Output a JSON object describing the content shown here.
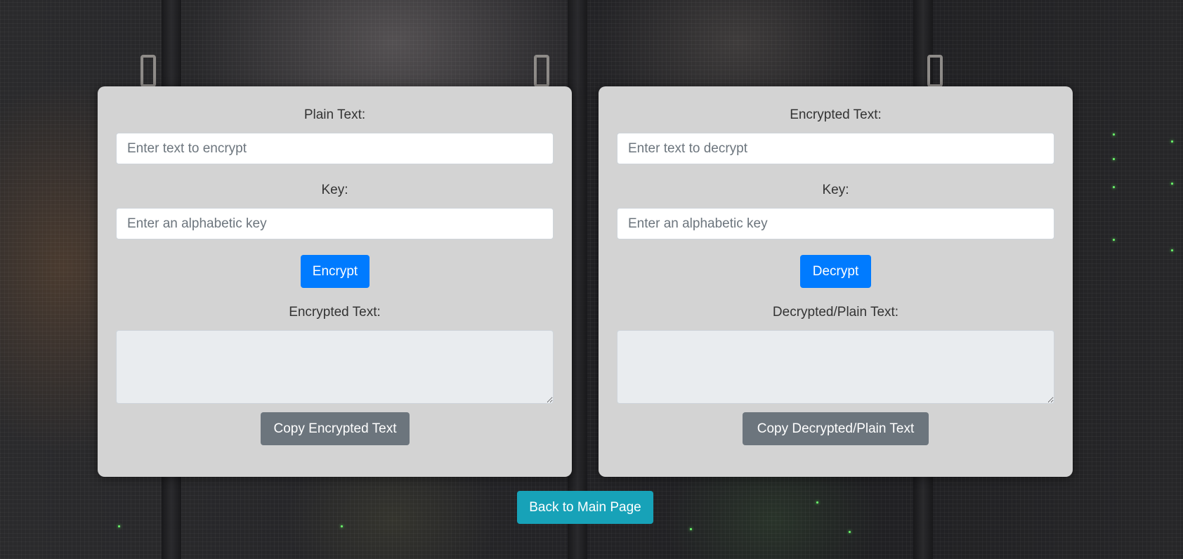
{
  "encrypt_panel": {
    "plain_label": "Plain Text:",
    "plain_placeholder": "Enter text to encrypt",
    "key_label": "Key:",
    "key_placeholder": "Enter an alphabetic key",
    "action_label": "Encrypt",
    "output_label": "Encrypted Text:",
    "output_value": "",
    "copy_label": "Copy Encrypted Text"
  },
  "decrypt_panel": {
    "cipher_label": "Encrypted Text:",
    "cipher_placeholder": "Enter text to decrypt",
    "key_label": "Key:",
    "key_placeholder": "Enter an alphabetic key",
    "action_label": "Decrypt",
    "output_label": "Decrypted/Plain Text:",
    "output_value": "",
    "copy_label": "Copy Decrypted/Plain Text"
  },
  "footer": {
    "back_label": "Back to Main Page"
  },
  "colors": {
    "primary": "#007bff",
    "secondary": "#6c757d",
    "info": "#17a2b8",
    "card_bg": "#d3d3d3",
    "readonly_bg": "#e9ecef"
  }
}
